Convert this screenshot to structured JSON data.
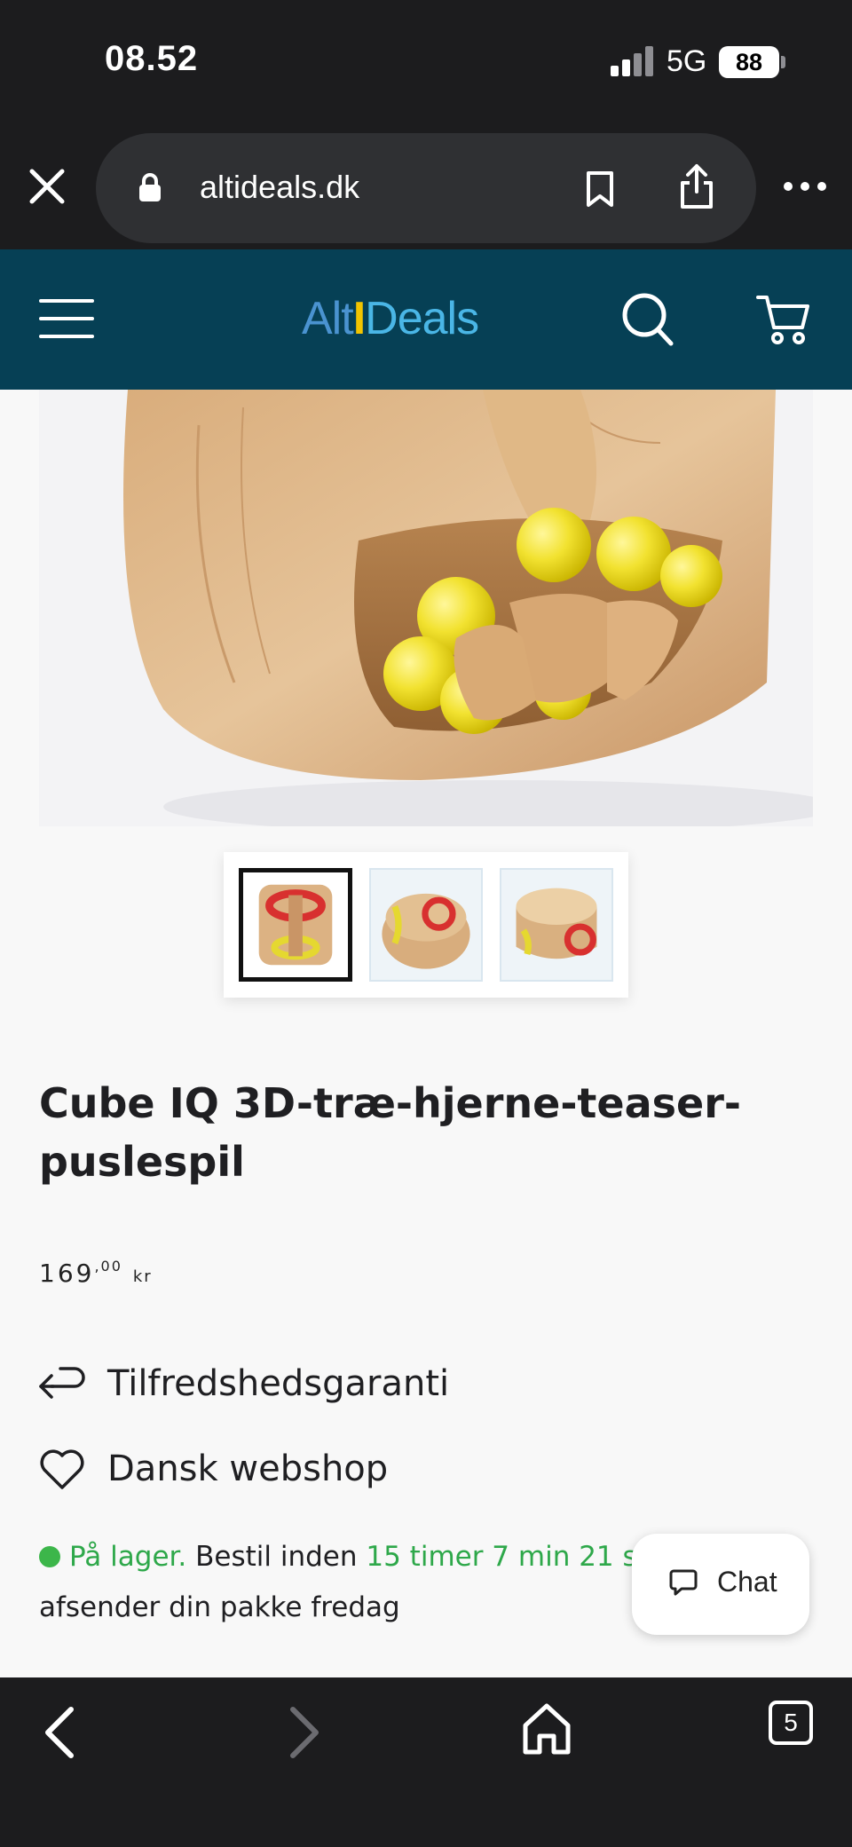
{
  "status_bar": {
    "time": "08.52",
    "network": "5G",
    "battery": "88"
  },
  "browser": {
    "url": "altideals.dk"
  },
  "site": {
    "logo_part1": "Alt",
    "logo_part2": "I",
    "logo_part3": "Deals"
  },
  "product": {
    "title": "Cube IQ 3D-træ-hjerne-teaser-puslespil",
    "price_main": "169",
    "price_decimals": ",00",
    "price_currency": "kr",
    "thumbnails": [
      "thumb-1",
      "thumb-2",
      "thumb-3"
    ],
    "selected_thumbnail": 0,
    "features": [
      {
        "icon": "return-arrow-icon",
        "label": "Tilfredshedsgaranti"
      },
      {
        "icon": "heart-icon",
        "label": "Dansk webshop"
      }
    ],
    "stock": {
      "status": "På lager.",
      "order_before": "Bestil inden",
      "countdown": "15 timer 7 min 21 s",
      "dispatch": "afsender din pakke fredag"
    }
  },
  "chat": {
    "label": "Chat"
  },
  "bottom_bar": {
    "tab_count": "5"
  },
  "colors": {
    "header_bg": "#064055",
    "browser_bg": "#1c1c1e",
    "stock_green": "#2ea84a",
    "logo_blue": "#4a93d0",
    "logo_yellow": "#f2c400"
  }
}
